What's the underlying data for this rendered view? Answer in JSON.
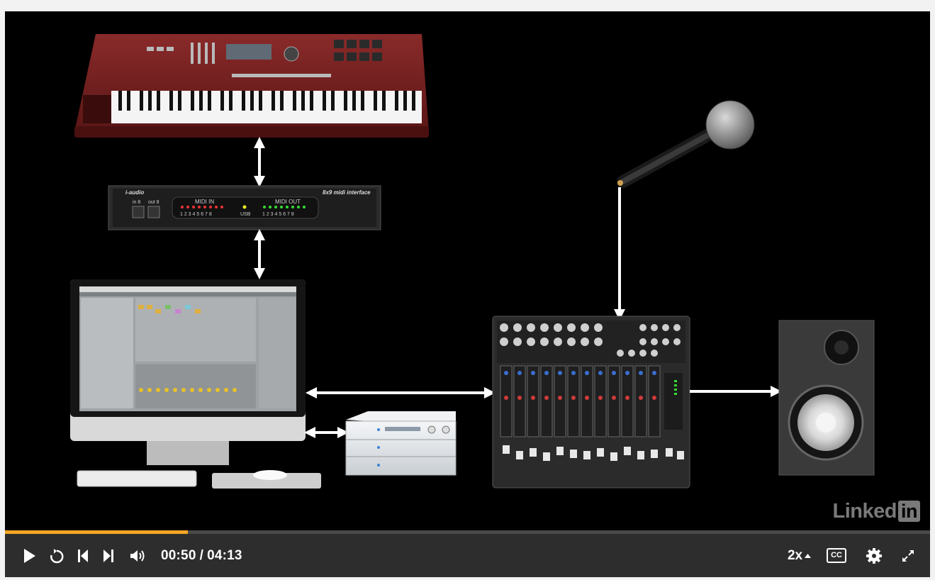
{
  "player": {
    "watermark_text": "Linked",
    "watermark_in": "in",
    "progress_fraction": 0.198,
    "colors": {
      "progress": "#f5a623",
      "controls_bg": "#2d2d2d",
      "stage_bg": "#000000"
    }
  },
  "controls": {
    "current_time": "00:50",
    "separator": "/",
    "total_time": "04:13",
    "speed": "2x",
    "cc_label": "CC"
  },
  "diagram": {
    "midi_interface": {
      "brand": "i-audio",
      "model": "8x9 midi interface",
      "in_label": "in 8",
      "out_label": "out 8",
      "midi_in_label": "MIDI IN",
      "midi_out_label": "MIDI OUT",
      "midi_in_numbers": "1 2 3 4 5 6 7 8",
      "midi_out_numbers": "1 2 3 4 5 6 7 8",
      "usb_label": "USB"
    }
  },
  "icons": [
    "play-icon",
    "replay-icon",
    "previous-icon",
    "next-icon",
    "volume-icon",
    "caret-up-icon",
    "gear-icon",
    "fullscreen-icon"
  ]
}
